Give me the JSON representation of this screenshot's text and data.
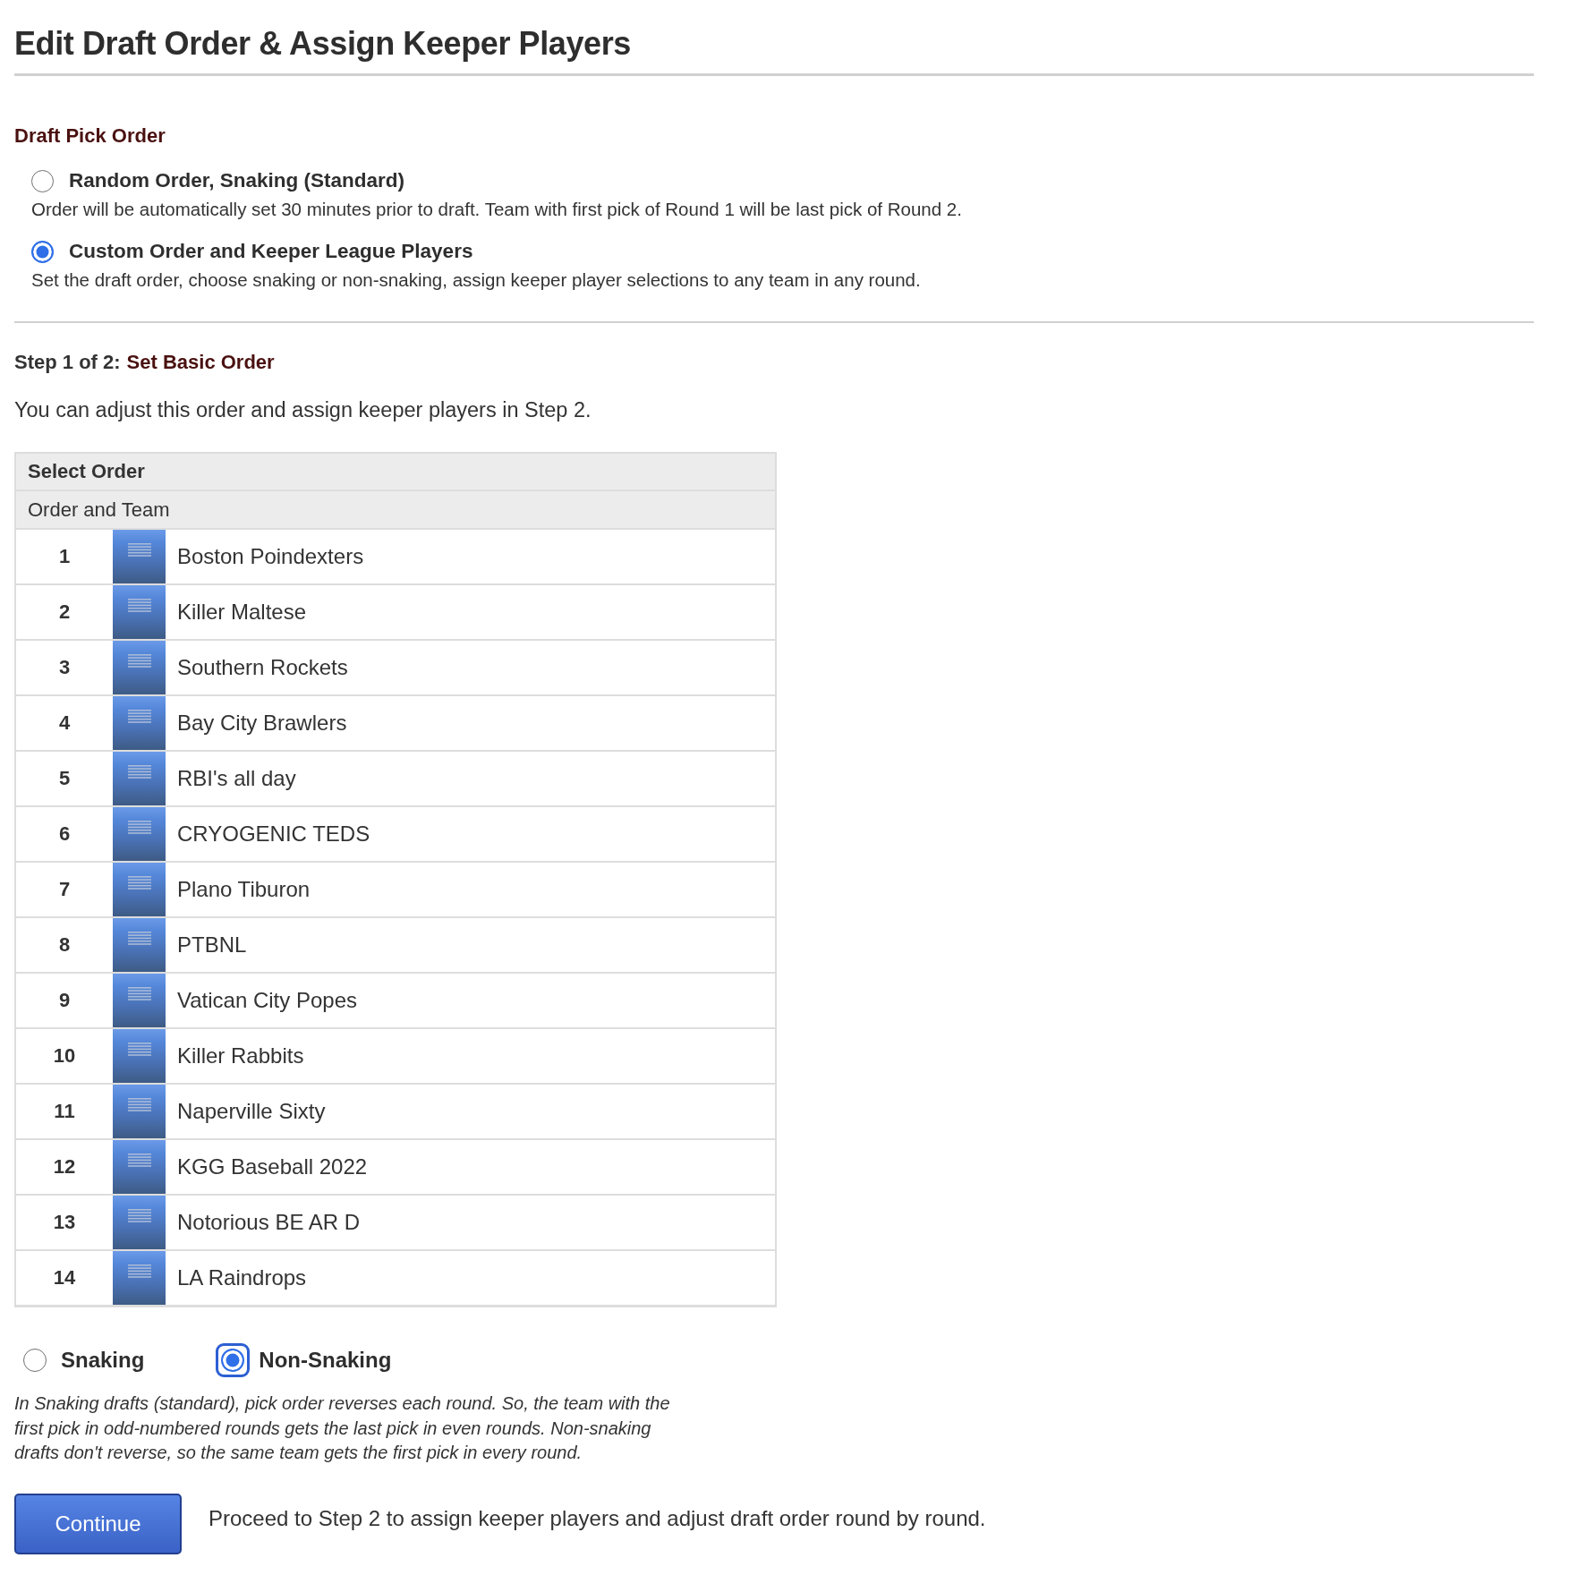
{
  "page": {
    "title": "Edit Draft Order & Assign Keeper Players"
  },
  "draft_pick_order": {
    "heading": "Draft Pick Order",
    "options": [
      {
        "label": "Random Order, Snaking (Standard)",
        "description": "Order will be automatically set 30 minutes prior to draft. Team with first pick of Round 1 will be last pick of Round 2.",
        "selected": false
      },
      {
        "label": "Custom Order and Keeper League Players",
        "description": "Set the draft order, choose snaking or non-snaking, assign keeper player selections to any team in any round.",
        "selected": true
      }
    ]
  },
  "step": {
    "label": "Step 1 of 2:",
    "title": "Set Basic Order",
    "instructions": "You can adjust this order and assign keeper players in Step 2."
  },
  "order_table": {
    "title": "Select Order",
    "column_header": "Order and Team",
    "rows": [
      {
        "number": "1",
        "team": "Boston Poindexters"
      },
      {
        "number": "2",
        "team": "Killer Maltese"
      },
      {
        "number": "3",
        "team": "Southern Rockets"
      },
      {
        "number": "4",
        "team": "Bay City Brawlers"
      },
      {
        "number": "5",
        "team": "RBI's all day"
      },
      {
        "number": "6",
        "team": "CRYOGENIC TEDS"
      },
      {
        "number": "7",
        "team": "Plano Tiburon"
      },
      {
        "number": "8",
        "team": "PTBNL"
      },
      {
        "number": "9",
        "team": "Vatican City Popes"
      },
      {
        "number": "10",
        "team": "Killer Rabbits"
      },
      {
        "number": "11",
        "team": "Naperville Sixty"
      },
      {
        "number": "12",
        "team": "KGG Baseball 2022"
      },
      {
        "number": "13",
        "team": "Notorious BE AR D"
      },
      {
        "number": "14",
        "team": "LA Raindrops"
      }
    ]
  },
  "draft_type": {
    "options": [
      {
        "label": "Snaking",
        "selected": false,
        "focused": false
      },
      {
        "label": "Non-Snaking",
        "selected": true,
        "focused": true
      }
    ],
    "note": "In Snaking drafts (standard), pick order reverses each round. So, the team with the first pick in odd-numbered rounds gets the last pick in even rounds. Non-snaking drafts don't reverse, so the same team gets the first pick in every round."
  },
  "continue": {
    "button": "Continue",
    "description": "Proceed to Step 2 to assign keeper players and adjust draft order round by round."
  }
}
